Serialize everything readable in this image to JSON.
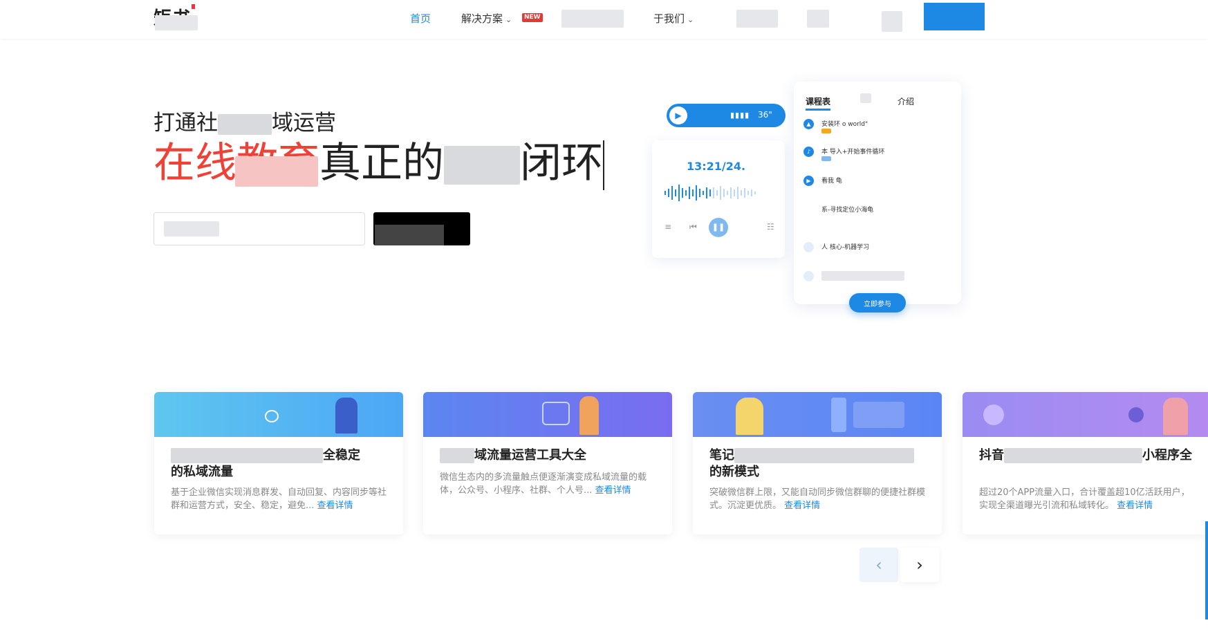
{
  "nav": {
    "logo": "矩书",
    "items": [
      {
        "label": "首页",
        "active": true
      },
      {
        "label": "解决方案",
        "badge": "NEW",
        "has_dropdown": true
      },
      {
        "label": "于我们",
        "has_dropdown": true
      }
    ]
  },
  "hero": {
    "subtitle_a": "打通社",
    "subtitle_b": "域运营",
    "title_red": "在线教育",
    "title_dark_a": "真正的",
    "title_dark_b": "闭环"
  },
  "illustration": {
    "audio_duration": "36\"",
    "player_time": "13:21/24.",
    "course_tabs": [
      "课程表",
      "介绍"
    ],
    "course_items": [
      {
        "text": "安装环         o world\""
      },
      {
        "text": "本      导入+开始事件循环"
      },
      {
        "text": "看我         龟"
      },
      {
        "text": "       系-寻找定位小海龟"
      },
      {
        "text": "人       核心-机器学习"
      }
    ],
    "join_button": "立即参与"
  },
  "cards": [
    {
      "title_a": "全稳定",
      "title_b": "的私域流量",
      "desc": "基于企业微信实现消息群发、自动回复、内容同步等社群和运营方式，安全、稳定，避免...",
      "link": "查看详情"
    },
    {
      "title_a": "域流量运营工具大全",
      "title_b": "",
      "desc": "微信生态内的多流量触点便逐渐演变成私域流量的载体，公众号、小程序、社群、个人号...",
      "link": "查看详情"
    },
    {
      "title_a": "笔记",
      "title_b": "的新模式",
      "desc": "突破微信群上限，又能自动同步微信群聊的便捷社群模式。沉淀更优质。",
      "link": "查看详情"
    },
    {
      "title_a": "抖音",
      "title_b": "小程序全",
      "desc": "超过20个APP流量入口，合计覆盖超10亿活跃用户，实现全渠道曝光引流和私域转化。",
      "link": "查看详情"
    }
  ],
  "pager": {
    "prev": "‹",
    "next": "›"
  },
  "colors": {
    "accent": "#1e88e5",
    "hero_red": "#ef4136"
  }
}
